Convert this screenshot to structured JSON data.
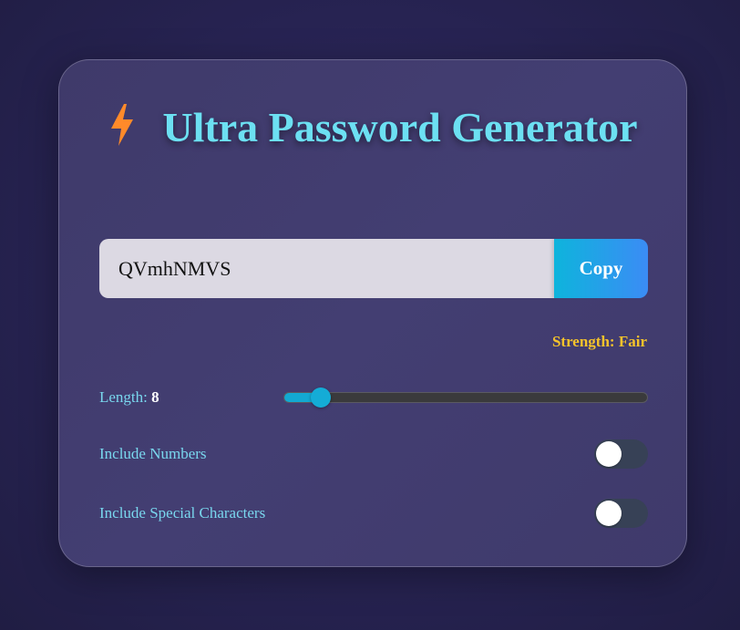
{
  "app": {
    "title": "Ultra Password Generator",
    "title_icon": "lightning-bolt-icon"
  },
  "password": {
    "value": "QVmhNMVS",
    "copy_label": "Copy"
  },
  "strength": {
    "text": "Strength: Fair",
    "color": "#f5c32b"
  },
  "length": {
    "label": "Length: ",
    "value": "8",
    "slider_fraction": 0.1
  },
  "options": {
    "numbers": {
      "label": "Include Numbers",
      "enabled": false
    },
    "special": {
      "label": "Include Special Characters",
      "enabled": false
    }
  },
  "colors": {
    "accent": "#6ce0f2",
    "copy_gradient_start": "#0eb4dc",
    "copy_gradient_end": "#3b8cf5",
    "bolt": "#ff8a2a"
  }
}
